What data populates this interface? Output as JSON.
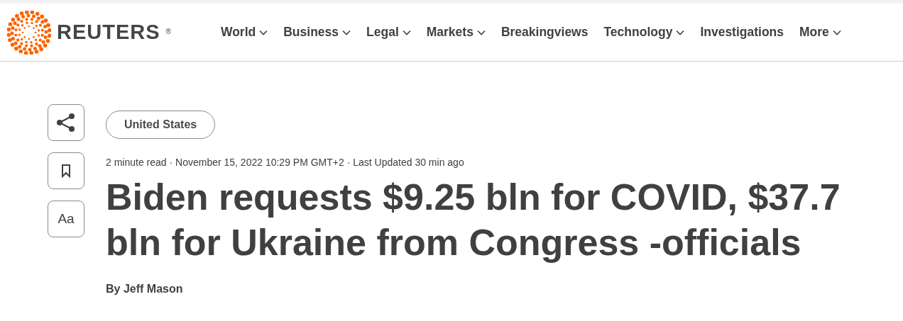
{
  "header": {
    "logo": {
      "wordmark": "REUTERS",
      "registered": "®"
    },
    "nav": [
      {
        "label": "World",
        "has_menu": true
      },
      {
        "label": "Business",
        "has_menu": true
      },
      {
        "label": "Legal",
        "has_menu": true
      },
      {
        "label": "Markets",
        "has_menu": true
      },
      {
        "label": "Breakingviews",
        "has_menu": false
      },
      {
        "label": "Technology",
        "has_menu": true
      },
      {
        "label": "Investigations",
        "has_menu": false
      },
      {
        "label": "More",
        "has_menu": true
      }
    ]
  },
  "tools": [
    {
      "kind": "share"
    },
    {
      "kind": "bookmark"
    },
    {
      "kind": "text",
      "label": "Aa"
    }
  ],
  "article": {
    "tag": "United States",
    "meta": "2 minute read · November 15, 2022 10:29 PM GMT+2 · Last Updated 30 min ago",
    "headline": "Biden requests $9.25 bln for COVID, $37.7 bln for Ukraine from Congress -officials",
    "byline": "By Jeff Mason"
  }
}
